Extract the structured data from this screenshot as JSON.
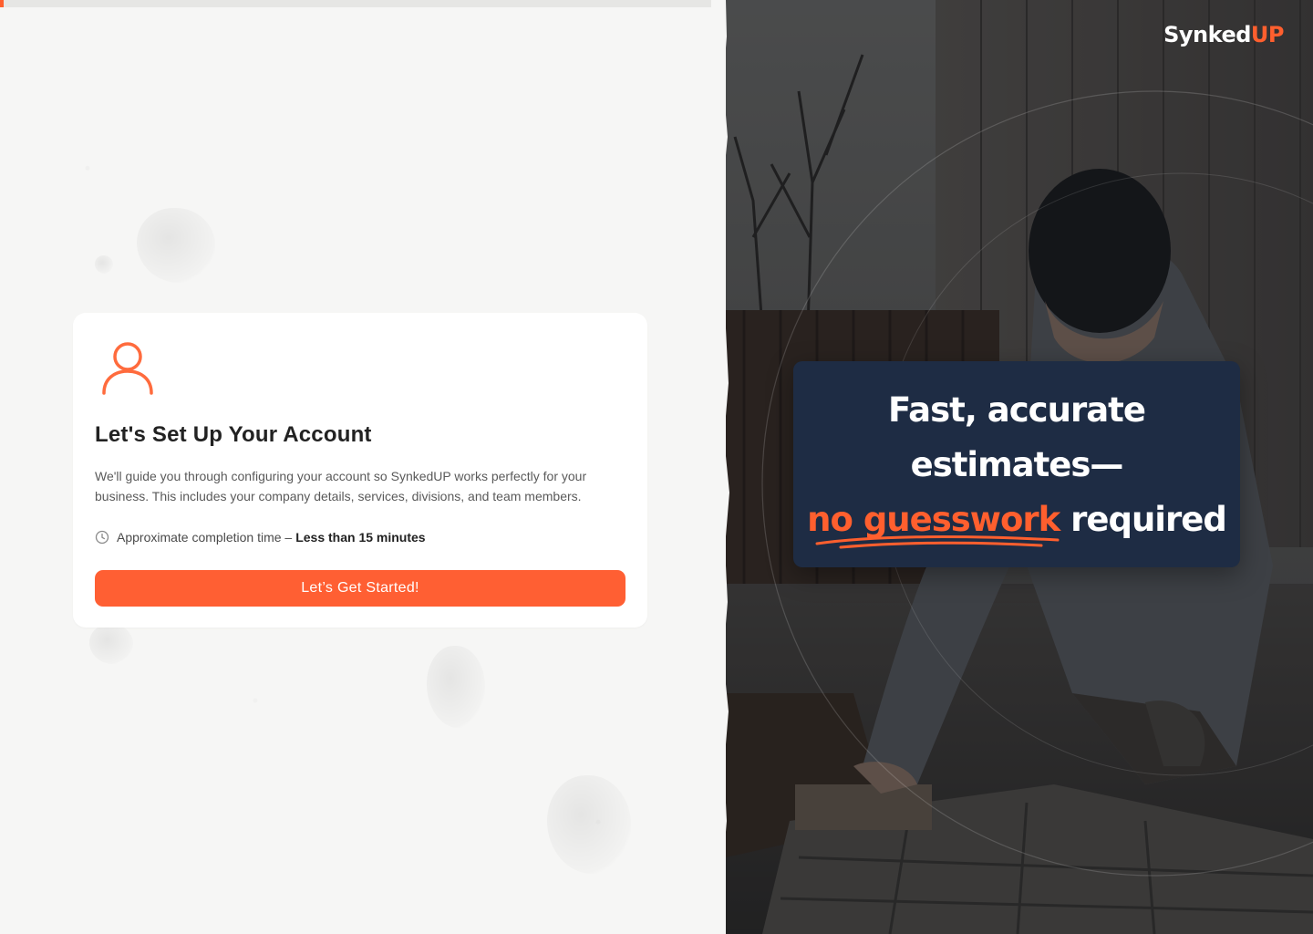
{
  "progress": {
    "fraction": 0.005
  },
  "setup_card": {
    "icon": "user-icon",
    "title": "Let's Set Up Your Account",
    "description": "We'll guide you through configuring your account so SynkedUP works perfectly for your business. This includes your company details, services, divisions, and team members.",
    "time_label": "Approximate completion time –",
    "time_value": "Less than 15 minutes",
    "time_icon": "clock-icon",
    "cta_label": "Let’s Get Started!"
  },
  "brand": {
    "logo_text_main": "Synked",
    "logo_text_accent": "UP",
    "accent_color": "#ff5f2e",
    "navy": "#1e2c44"
  },
  "hero": {
    "line1": "Fast, accurate",
    "line2": "estimates—",
    "line3_highlight": "no guesswork",
    "line3_rest": "required"
  }
}
